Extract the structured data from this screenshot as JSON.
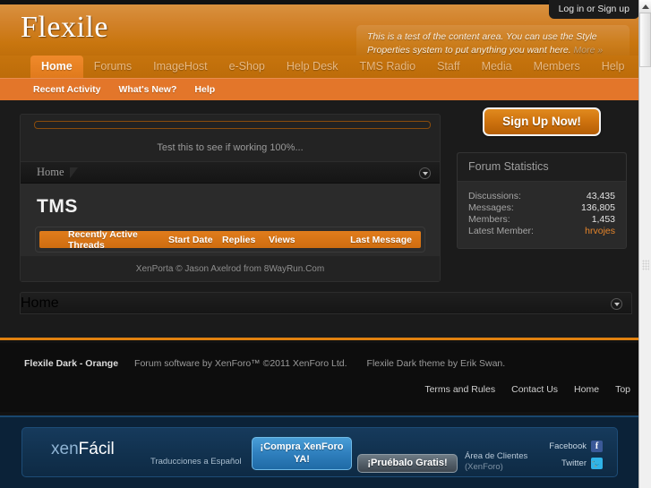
{
  "browser": {
    "scrollbar_up_arrow": "▲"
  },
  "header": {
    "logo": "Flexile",
    "login_button": "Log in or Sign up",
    "notice_text": "This is a test of the content area. You can use the Style Properties system to put anything you want here.",
    "notice_more": "More »"
  },
  "nav": {
    "items": [
      {
        "label": "Home",
        "active": true
      },
      {
        "label": "Forums",
        "active": false
      },
      {
        "label": "ImageHost",
        "active": false
      },
      {
        "label": "e-Shop",
        "active": false
      },
      {
        "label": "Help Desk",
        "active": false
      },
      {
        "label": "TMS Radio",
        "active": false
      },
      {
        "label": "Staff",
        "active": false
      },
      {
        "label": "Media",
        "active": false
      },
      {
        "label": "Members",
        "active": false
      },
      {
        "label": "Help",
        "active": false
      }
    ]
  },
  "subnav": {
    "items": [
      {
        "label": "Recent Activity"
      },
      {
        "label": "What's New?"
      },
      {
        "label": "Help"
      }
    ]
  },
  "content": {
    "test_text": "Test this to see if working 100%...",
    "breadcrumb": "Home",
    "section_title": "TMS",
    "table_headers": {
      "threads": "Recently Active Threads",
      "start_date": "Start Date",
      "replies": "Replies",
      "views": "Views",
      "last_message": "Last Message"
    },
    "credit": "XenPorta © Jason Axelrod from 8WayRun.Com",
    "bottom_breadcrumb": "Home"
  },
  "sidebar": {
    "signup_button": "Sign Up Now!",
    "stats_title": "Forum Statistics",
    "stats": [
      {
        "label": "Discussions:",
        "value": "43,435",
        "accent": false
      },
      {
        "label": "Messages:",
        "value": "136,805",
        "accent": false
      },
      {
        "label": "Members:",
        "value": "1,453",
        "accent": false
      },
      {
        "label": "Latest Member:",
        "value": "hrvojes",
        "accent": true
      }
    ]
  },
  "footer": {
    "copyright": "Flexile Dark - Orange",
    "software": "Forum software by XenForo™ ©2011 XenForo Ltd.",
    "theme": "Flexile Dark theme by Erik Swan.",
    "links": [
      "Terms and Rules",
      "Contact Us",
      "Home",
      "Top"
    ]
  },
  "xenfacil": {
    "logo_prefix": "xen",
    "logo_suffix": "Fácil",
    "tagline": "Traducciones a Español",
    "buy_button": "¡Compra XenForo YA!",
    "trial_button": "¡Pruébalo Gratis!",
    "client_area": "Área de Clientes",
    "client_area_sub": "(XenForo)",
    "facebook_label": "Facebook",
    "twitter_label": "Twitter",
    "facebook_glyph": "f",
    "twitter_glyph": "🐦"
  },
  "colors": {
    "accent_orange": "#e0810f",
    "nav_orange": "#e3762a",
    "dark_bg": "#1b1b1b",
    "panel_bg": "#2b2b2b",
    "blue_panel": "#11314e"
  }
}
